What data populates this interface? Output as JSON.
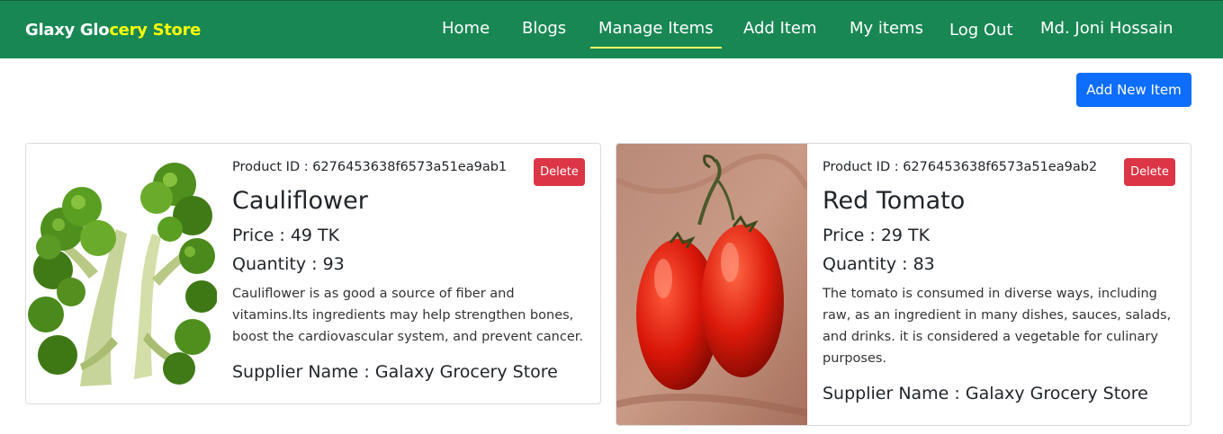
{
  "navbar": {
    "brand_part1": "Glaxy Glo",
    "brand_part2": "cery Store",
    "links": [
      "Home",
      "Blogs",
      "Manage Items",
      "Add Item",
      "My items",
      "Log Out"
    ],
    "active_link": "Manage Items",
    "user_name": "Md. Joni Hossain",
    "bg_color": "#198754",
    "brand_accent_color": "#ffff00"
  },
  "toolbar": {
    "add_new_label": "Add New Item",
    "add_new_color": "#0d6efd"
  },
  "items": [
    {
      "product_id_label": "Product ID : 6276453638f6573a51ea9ab1",
      "delete_label": "Delete",
      "name": "Cauliflower",
      "price": "Price : 49 TK",
      "quantity": "Quantity : 93",
      "description": "Cauliflower is as good a source of fiber and vitamins.Its ingredients may help strengthen bones, boost the cardiovascular system, and prevent cancer.",
      "supplier": "Supplier Name : Galaxy Grocery Store",
      "image": "broccoli-photo"
    },
    {
      "product_id_label": "Product ID : 6276453638f6573a51ea9ab2",
      "delete_label": "Delete",
      "name": "Red Tomato",
      "price": "Price : 29 TK",
      "quantity": "Quantity : 83",
      "description": "The tomato is consumed in diverse ways, including raw, as an ingredient in many dishes, sauces, salads, and drinks. it is considered a vegetable for culinary purposes.",
      "supplier": "Supplier Name : Galaxy Grocery Store",
      "image": "tomato-photo"
    }
  ],
  "delete_color": "#dc3545"
}
